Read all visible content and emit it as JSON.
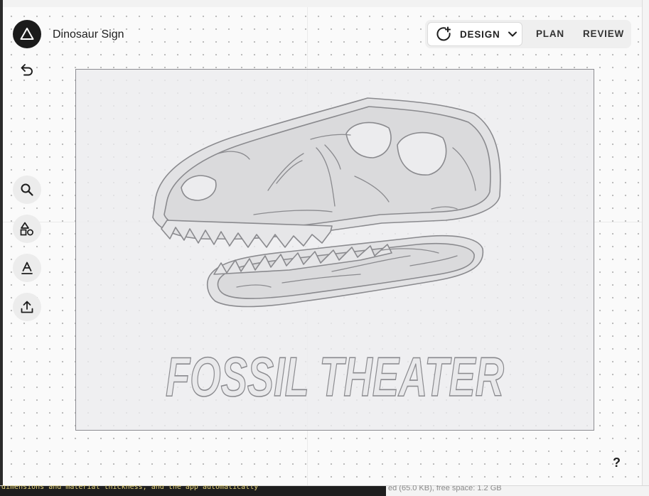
{
  "project": {
    "title": "Dinosaur Sign"
  },
  "modes": {
    "design_label": "DESIGN",
    "plan_label": "PLAN",
    "review_label": "REVIEW",
    "active": "DESIGN"
  },
  "tools": [
    {
      "name": "search",
      "icon": "search-icon"
    },
    {
      "name": "shapes",
      "icon": "shapes-icon"
    },
    {
      "name": "text",
      "icon": "text-icon"
    },
    {
      "name": "upload",
      "icon": "upload-icon"
    }
  ],
  "canvas": {
    "sign_text": "FOSSIL THEATER",
    "artwork": "t-rex-skull-icon"
  },
  "help": {
    "label": "?"
  },
  "background": {
    "terminal_text": "dimensions and material thickness, and the app automatically",
    "status_text": "ed (65.0 KB), free space: 1.2 GB"
  },
  "colors": {
    "accent_dark": "#1b1b1b",
    "artboard_fill": "#ececee",
    "artboard_stroke": "#8d8d92",
    "artwork_stroke": "#8a8a8e"
  }
}
